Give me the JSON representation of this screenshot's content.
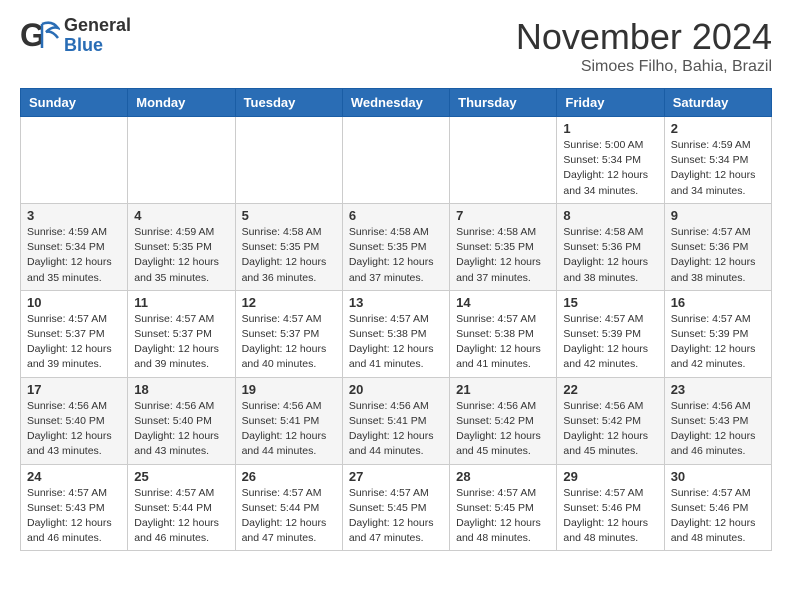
{
  "header": {
    "logo_general": "General",
    "logo_blue": "Blue",
    "month_title": "November 2024",
    "location": "Simoes Filho, Bahia, Brazil"
  },
  "weekdays": [
    "Sunday",
    "Monday",
    "Tuesday",
    "Wednesday",
    "Thursday",
    "Friday",
    "Saturday"
  ],
  "weeks": [
    [
      {
        "day": "",
        "info": ""
      },
      {
        "day": "",
        "info": ""
      },
      {
        "day": "",
        "info": ""
      },
      {
        "day": "",
        "info": ""
      },
      {
        "day": "",
        "info": ""
      },
      {
        "day": "1",
        "info": "Sunrise: 5:00 AM\nSunset: 5:34 PM\nDaylight: 12 hours\nand 34 minutes."
      },
      {
        "day": "2",
        "info": "Sunrise: 4:59 AM\nSunset: 5:34 PM\nDaylight: 12 hours\nand 34 minutes."
      }
    ],
    [
      {
        "day": "3",
        "info": "Sunrise: 4:59 AM\nSunset: 5:34 PM\nDaylight: 12 hours\nand 35 minutes."
      },
      {
        "day": "4",
        "info": "Sunrise: 4:59 AM\nSunset: 5:35 PM\nDaylight: 12 hours\nand 35 minutes."
      },
      {
        "day": "5",
        "info": "Sunrise: 4:58 AM\nSunset: 5:35 PM\nDaylight: 12 hours\nand 36 minutes."
      },
      {
        "day": "6",
        "info": "Sunrise: 4:58 AM\nSunset: 5:35 PM\nDaylight: 12 hours\nand 37 minutes."
      },
      {
        "day": "7",
        "info": "Sunrise: 4:58 AM\nSunset: 5:35 PM\nDaylight: 12 hours\nand 37 minutes."
      },
      {
        "day": "8",
        "info": "Sunrise: 4:58 AM\nSunset: 5:36 PM\nDaylight: 12 hours\nand 38 minutes."
      },
      {
        "day": "9",
        "info": "Sunrise: 4:57 AM\nSunset: 5:36 PM\nDaylight: 12 hours\nand 38 minutes."
      }
    ],
    [
      {
        "day": "10",
        "info": "Sunrise: 4:57 AM\nSunset: 5:37 PM\nDaylight: 12 hours\nand 39 minutes."
      },
      {
        "day": "11",
        "info": "Sunrise: 4:57 AM\nSunset: 5:37 PM\nDaylight: 12 hours\nand 39 minutes."
      },
      {
        "day": "12",
        "info": "Sunrise: 4:57 AM\nSunset: 5:37 PM\nDaylight: 12 hours\nand 40 minutes."
      },
      {
        "day": "13",
        "info": "Sunrise: 4:57 AM\nSunset: 5:38 PM\nDaylight: 12 hours\nand 41 minutes."
      },
      {
        "day": "14",
        "info": "Sunrise: 4:57 AM\nSunset: 5:38 PM\nDaylight: 12 hours\nand 41 minutes."
      },
      {
        "day": "15",
        "info": "Sunrise: 4:57 AM\nSunset: 5:39 PM\nDaylight: 12 hours\nand 42 minutes."
      },
      {
        "day": "16",
        "info": "Sunrise: 4:57 AM\nSunset: 5:39 PM\nDaylight: 12 hours\nand 42 minutes."
      }
    ],
    [
      {
        "day": "17",
        "info": "Sunrise: 4:56 AM\nSunset: 5:40 PM\nDaylight: 12 hours\nand 43 minutes."
      },
      {
        "day": "18",
        "info": "Sunrise: 4:56 AM\nSunset: 5:40 PM\nDaylight: 12 hours\nand 43 minutes."
      },
      {
        "day": "19",
        "info": "Sunrise: 4:56 AM\nSunset: 5:41 PM\nDaylight: 12 hours\nand 44 minutes."
      },
      {
        "day": "20",
        "info": "Sunrise: 4:56 AM\nSunset: 5:41 PM\nDaylight: 12 hours\nand 44 minutes."
      },
      {
        "day": "21",
        "info": "Sunrise: 4:56 AM\nSunset: 5:42 PM\nDaylight: 12 hours\nand 45 minutes."
      },
      {
        "day": "22",
        "info": "Sunrise: 4:56 AM\nSunset: 5:42 PM\nDaylight: 12 hours\nand 45 minutes."
      },
      {
        "day": "23",
        "info": "Sunrise: 4:56 AM\nSunset: 5:43 PM\nDaylight: 12 hours\nand 46 minutes."
      }
    ],
    [
      {
        "day": "24",
        "info": "Sunrise: 4:57 AM\nSunset: 5:43 PM\nDaylight: 12 hours\nand 46 minutes."
      },
      {
        "day": "25",
        "info": "Sunrise: 4:57 AM\nSunset: 5:44 PM\nDaylight: 12 hours\nand 46 minutes."
      },
      {
        "day": "26",
        "info": "Sunrise: 4:57 AM\nSunset: 5:44 PM\nDaylight: 12 hours\nand 47 minutes."
      },
      {
        "day": "27",
        "info": "Sunrise: 4:57 AM\nSunset: 5:45 PM\nDaylight: 12 hours\nand 47 minutes."
      },
      {
        "day": "28",
        "info": "Sunrise: 4:57 AM\nSunset: 5:45 PM\nDaylight: 12 hours\nand 48 minutes."
      },
      {
        "day": "29",
        "info": "Sunrise: 4:57 AM\nSunset: 5:46 PM\nDaylight: 12 hours\nand 48 minutes."
      },
      {
        "day": "30",
        "info": "Sunrise: 4:57 AM\nSunset: 5:46 PM\nDaylight: 12 hours\nand 48 minutes."
      }
    ]
  ]
}
